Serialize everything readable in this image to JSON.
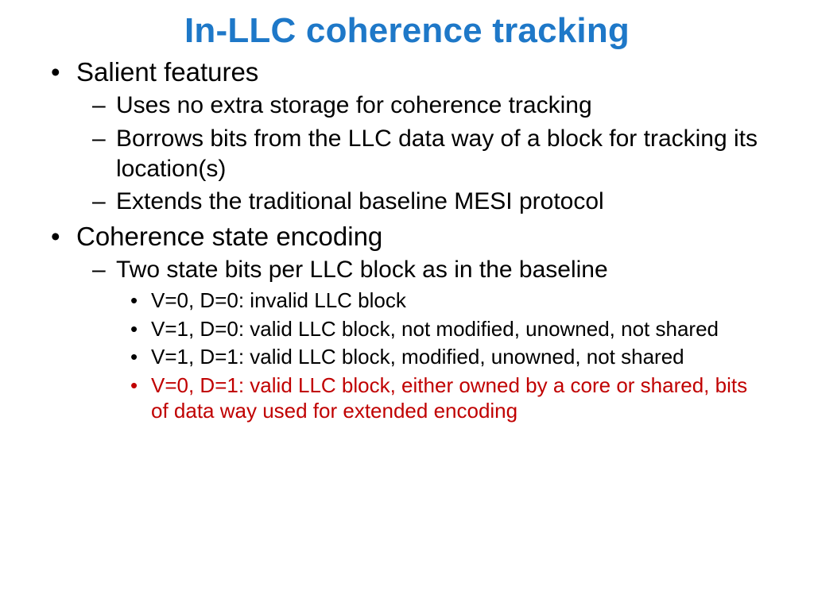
{
  "title": "In-LLC coherence tracking",
  "l1a": "Salient features",
  "l2a": "Uses no extra storage for coherence tracking",
  "l2b": "Borrows bits from the LLC data way of a block for tracking its location(s)",
  "l2c": "Extends the traditional baseline MESI protocol",
  "l1b": "Coherence state encoding",
  "l2d": "Two state bits per LLC block as in the baseline",
  "l3a": "V=0, D=0: invalid LLC block",
  "l3b": "V=1, D=0: valid LLC block, not modified, unowned, not shared",
  "l3c": "V=1, D=1: valid LLC block, modified, unowned, not shared",
  "l3d": "V=0, D=1: valid LLC block, either owned by a core or shared, bits of data way used for extended encoding"
}
